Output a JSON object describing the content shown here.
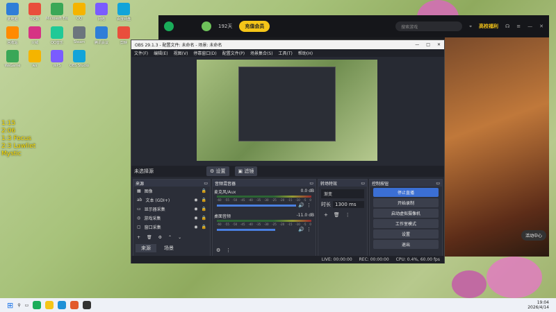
{
  "desktop": {
    "icons": [
      "此电脑",
      "T记数",
      "Microsoft Edge",
      "QQ",
      "网络",
      "百度网盘",
      "回收站",
      "火绒",
      "QQ音乐",
      "Steam",
      "腾讯会议",
      "剪映",
      "WeGame",
      "wx",
      "WPS",
      "OBS Studio"
    ],
    "overlay_lines": [
      "1:15",
      "2:06",
      "1:3 Focus",
      "2:3 Lawliet",
      "Mystic"
    ]
  },
  "launcher": {
    "days": "192天",
    "vip_button": "充值会员",
    "search_placeholder": "搜索游戏",
    "promo": "高校福利",
    "activity": "活动中心"
  },
  "obs": {
    "title": "OBS 29.1.3 - 配置文件: 未命名 - 场景: 未命名",
    "menu": [
      "文件(F)",
      "编辑(E)",
      "视图(V)",
      "停靠窗口(D)",
      "配置文件(P)",
      "场景集合(S)",
      "工具(T)",
      "帮助(H)"
    ],
    "no_source_selected": "未选择源",
    "settings_btn": "设置",
    "filters_btn": "滤镜",
    "sources": {
      "title": "来源",
      "items": [
        "图像",
        "文本 (GDI+)",
        "显示器采集",
        "游戏采集",
        "窗口采集"
      ]
    },
    "mixer": {
      "title": "音频混音器",
      "channels": [
        {
          "name": "麦克风/Aux",
          "db": "0.0 dB"
        },
        {
          "name": "桌面音频",
          "db": "-11.0 dB"
        }
      ],
      "ticks": [
        "-60",
        "-55",
        "-50",
        "-45",
        "-40",
        "-35",
        "-30",
        "-25",
        "-20",
        "-15",
        "-10",
        "-5",
        "0"
      ]
    },
    "transitions": {
      "title": "转场特效",
      "type": "渐变",
      "duration_label": "时长",
      "duration": "1300 ms"
    },
    "controls": {
      "title": "控制按钮",
      "buttons": [
        "停止直播",
        "开始录制",
        "启动虚拟摄像机",
        "工作室模式",
        "设置",
        "退出"
      ]
    },
    "tabs": [
      "来源",
      "场景"
    ],
    "status": {
      "live": "LIVE: 00:00:00",
      "rec": "REC: 00:00:00",
      "cpu": "CPU: 0.4%, 60.00 fps"
    }
  },
  "taskbar": {
    "time": "19:04",
    "date": "2026/4/14"
  }
}
